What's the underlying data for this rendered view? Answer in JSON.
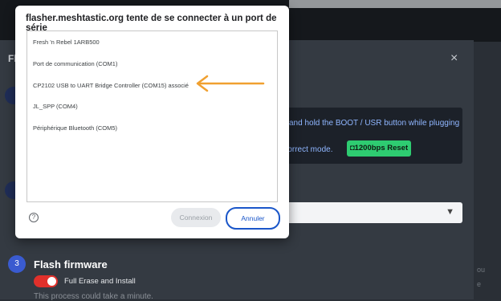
{
  "background": {
    "modal_title_fragment": "Fl",
    "close_glyph": "×",
    "info_line1": "and hold the BOOT / USR button while plugging",
    "info_line2": "n correct mode.",
    "reset_button": "1200bps Reset",
    "step3_number": "3",
    "flash_title": "Flash firmware",
    "toggle_label": "Full Erase and Install",
    "warning": "This process could take a minute.",
    "edge_text_1": "ou",
    "edge_text_2": "e"
  },
  "dialog": {
    "title": "flasher.meshtastic.org tente de se connecter à un port de série",
    "ports": [
      {
        "label": "Fresh 'n Rebel 1ARB500"
      },
      {
        "label": "Port de communication (COM1)"
      },
      {
        "label": "CP2102 USB to UART Bridge Controller (COM15) associé"
      },
      {
        "label": "JL_SPP (COM4)"
      },
      {
        "label": "Périphérique Bluetooth (COM5)"
      }
    ],
    "help_glyph": "?",
    "connect_label": "Connexion",
    "cancel_label": "Annuler"
  },
  "colors": {
    "annotation_arrow": "#f0a030",
    "cancel_border": "#1a56c9",
    "reset_green": "#2ecc71",
    "toggle_red": "#e0302b"
  }
}
